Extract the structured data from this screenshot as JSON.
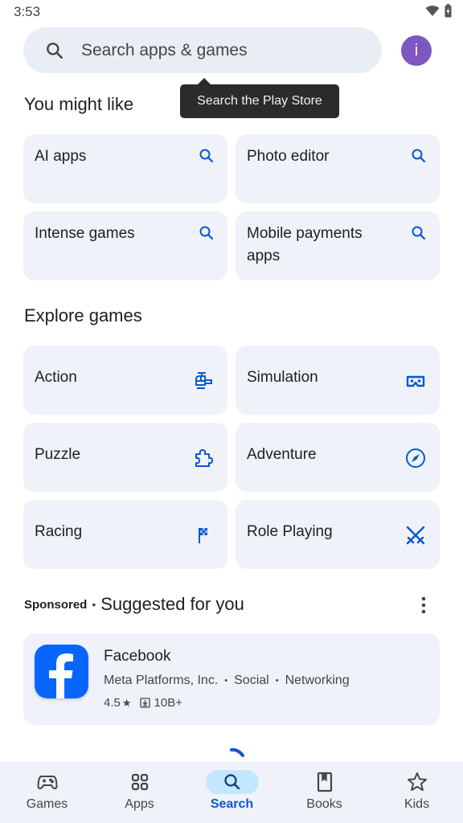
{
  "status_bar": {
    "time": "3:53",
    "icons": [
      "wifi-icon",
      "battery-charging-icon"
    ]
  },
  "search": {
    "placeholder": "Search apps & games",
    "icon": "search-icon"
  },
  "avatar": {
    "initial": "i",
    "color": "#7e57c2"
  },
  "tooltip": {
    "text": "Search the Play Store"
  },
  "you_might_like": {
    "title": "You might like",
    "items": [
      {
        "label": "AI apps",
        "icon": "search-icon"
      },
      {
        "label": "Photo editor",
        "icon": "search-icon"
      },
      {
        "label": "Intense games",
        "icon": "search-icon"
      },
      {
        "label": "Mobile payments apps",
        "icon": "search-icon"
      }
    ]
  },
  "explore_games": {
    "title": "Explore games",
    "items": [
      {
        "label": "Action",
        "icon": "helicopter-icon"
      },
      {
        "label": "Simulation",
        "icon": "vr-headset-icon"
      },
      {
        "label": "Puzzle",
        "icon": "puzzle-piece-icon"
      },
      {
        "label": "Adventure",
        "icon": "compass-icon"
      },
      {
        "label": "Racing",
        "icon": "checkered-flag-icon"
      },
      {
        "label": "Role Playing",
        "icon": "crossed-swords-icon"
      }
    ]
  },
  "suggested": {
    "sponsored_label": "Sponsored",
    "separator": "•",
    "title": "Suggested for you",
    "app": {
      "name": "Facebook",
      "developer": "Meta Platforms, Inc.",
      "categories": [
        "Social",
        "Networking"
      ],
      "rating": "4.5",
      "rating_icon": "★",
      "downloads": "10B+",
      "icon_color": "#0866ff"
    }
  },
  "bottom_nav": {
    "active": "Search",
    "items": [
      {
        "label": "Games",
        "icon": "gamepad-icon"
      },
      {
        "label": "Apps",
        "icon": "apps-grid-icon"
      },
      {
        "label": "Search",
        "icon": "search-icon"
      },
      {
        "label": "Books",
        "icon": "book-icon"
      },
      {
        "label": "Kids",
        "icon": "star-icon"
      }
    ]
  },
  "colors": {
    "accent": "#0b57d0",
    "card_bg": "#eff2f8",
    "search_bg": "#e9edf4",
    "nav_active_pill": "#c2e7ff"
  }
}
